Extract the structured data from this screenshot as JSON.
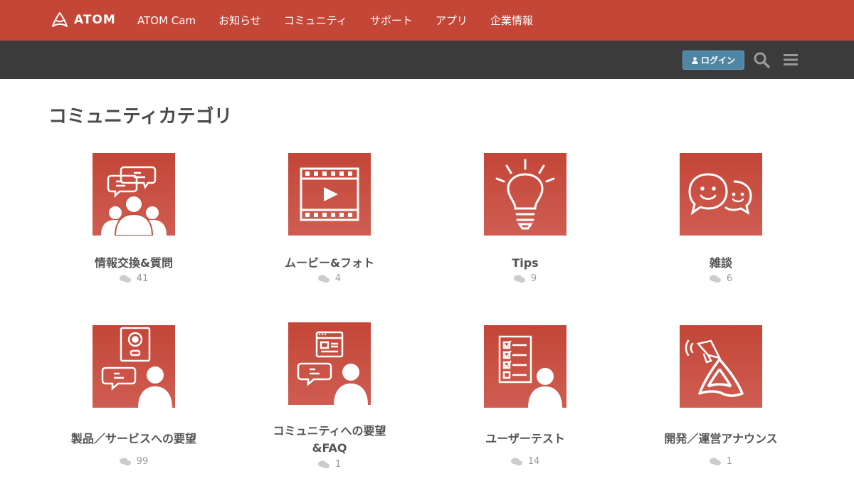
{
  "header": {
    "logo_text": "ATOM",
    "nav": [
      "ATOM Cam",
      "お知らせ",
      "コミュニティ",
      "サポート",
      "アプリ",
      "企業情報"
    ]
  },
  "toolbar": {
    "login_label": "ログイン",
    "search_icon": "search-icon",
    "menu_icon": "hamburger-menu-icon"
  },
  "page": {
    "title": "コミュニティカテゴリ"
  },
  "categories": [
    {
      "name": "情報交換&質問",
      "count": "41",
      "icon": "people-chat-icon"
    },
    {
      "name": "ムービー&フォト",
      "count": "4",
      "icon": "film-play-icon"
    },
    {
      "name": "Tips",
      "count": "9",
      "icon": "lightbulb-icon"
    },
    {
      "name": "雑談",
      "count": "6",
      "icon": "smiley-chat-icon"
    },
    {
      "name": "製品／サービスへの要望",
      "count": "99",
      "icon": "camera-request-icon"
    },
    {
      "name": "コミュニティへの要望",
      "name2": "&FAQ",
      "count": "1",
      "icon": "browser-request-icon"
    },
    {
      "name": "ユーザーテスト",
      "count": "14",
      "icon": "checklist-user-icon"
    },
    {
      "name": "開発／運営アナウンス",
      "count": "1",
      "icon": "megaphone-logo-icon"
    }
  ],
  "colors": {
    "brand_red": "#c34637",
    "subbar": "#3b3b3b",
    "login_blue": "#4f86a6"
  }
}
